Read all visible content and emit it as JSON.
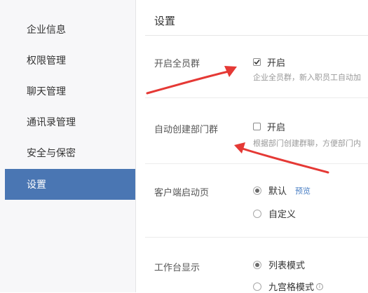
{
  "sidebar": {
    "items": [
      {
        "label": "企业信息"
      },
      {
        "label": "权限管理"
      },
      {
        "label": "聊天管理"
      },
      {
        "label": "通讯录管理"
      },
      {
        "label": "安全与保密"
      },
      {
        "label": "设置"
      }
    ],
    "active_index": 5
  },
  "main": {
    "title": "设置",
    "all_staff_group": {
      "label": "开启全员群",
      "option_label": "开启",
      "checked": true,
      "description": "企业全员群，新入职员工自动加"
    },
    "auto_dept_group": {
      "label": "自动创建部门群",
      "option_label": "开启",
      "checked": false,
      "description": "根据部门创建群聊，方便部门内"
    },
    "client_start_page": {
      "label": "客户端启动页",
      "options": [
        {
          "label": "默认",
          "selected": true
        },
        {
          "label": "自定义",
          "selected": false
        }
      ],
      "preview_link": "预览"
    },
    "workbench_display": {
      "label": "工作台显示",
      "options": [
        {
          "label": "列表模式",
          "selected": true
        },
        {
          "label": "九宫格模式",
          "selected": false
        }
      ],
      "info_icon": "i"
    }
  },
  "colors": {
    "active_nav": "#4a76b3",
    "arrow": "#e53935",
    "link": "#4a7fc4"
  }
}
